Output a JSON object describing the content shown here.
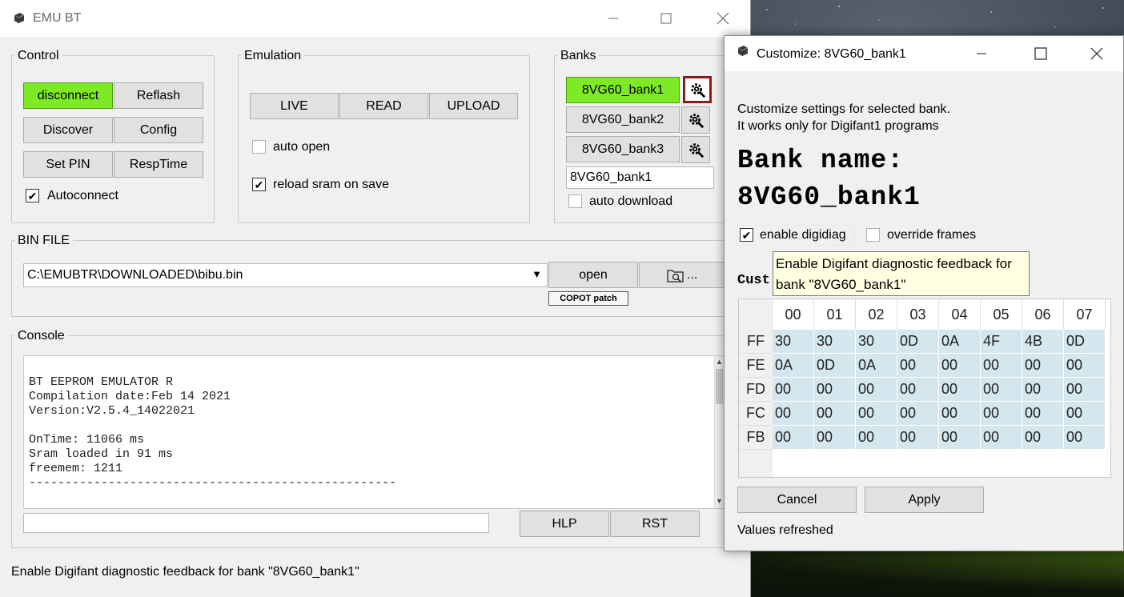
{
  "main_window": {
    "title": "EMU BT",
    "control": {
      "title": "Control",
      "disconnect": "disconnect",
      "reflash": "Reflash",
      "discover": "Discover",
      "config": "Config",
      "set_pin": "Set PIN",
      "resp_time": "RespTime",
      "autoconnect_label": "Autoconnect",
      "autoconnect_checked": true
    },
    "emulation": {
      "title": "Emulation",
      "live": "LIVE",
      "read": "READ",
      "upload": "UPLOAD",
      "auto_open_label": "auto open",
      "auto_open_checked": false,
      "reload_label": "reload sram on save",
      "reload_checked": true
    },
    "banks": {
      "title": "Banks",
      "items": [
        {
          "label": "8VG60_bank1",
          "active": true
        },
        {
          "label": "8VG60_bank2",
          "active": false
        },
        {
          "label": "8VG60_bank3",
          "active": false
        }
      ],
      "name_value": "8VG60_bank1",
      "auto_download_label": "auto download",
      "auto_download_checked": false
    },
    "bin_file": {
      "title": "BIN FILE",
      "path": "C:\\EMUBTR\\DOWNLOADED\\bibu.bin",
      "open": "open",
      "browse_label": "...",
      "copot_patch": "COPOT patch"
    },
    "console": {
      "title": "Console",
      "text": "BT EEPROM EMULATOR R\nCompilation date:Feb 14 2021\nVersion:V2.5.4_14022021\n\nOnTime: 11066 ms\nSram loaded in 91 ms\nfreemem: 1211\n---------------------------------------------------",
      "input_value": "",
      "hlp": "HLP",
      "rst": "RST"
    },
    "status_bar": "Enable Digifant diagnostic feedback for bank \"8VG60_bank1\""
  },
  "dialog": {
    "title": "Customize: 8VG60_bank1",
    "description_line1": "Customize settings for selected bank.",
    "description_line2": "It works only for Digifant1 programs",
    "bank_name_label": "Bank name:",
    "bank_name_value": "8VG60_bank1",
    "enable_digidiag_label": "enable digidiag",
    "enable_digidiag_checked": true,
    "override_frames_label": "override frames",
    "override_frames_checked": false,
    "custom_label_partial": "Cust",
    "grid": {
      "columns": [
        "00",
        "01",
        "02",
        "03",
        "04",
        "05",
        "06",
        "07"
      ],
      "rows": [
        {
          "label": "FF",
          "values": [
            "30",
            "30",
            "30",
            "0D",
            "0A",
            "4F",
            "4B",
            "0D"
          ]
        },
        {
          "label": "FE",
          "values": [
            "0A",
            "0D",
            "0A",
            "00",
            "00",
            "00",
            "00",
            "00"
          ]
        },
        {
          "label": "FD",
          "values": [
            "00",
            "00",
            "00",
            "00",
            "00",
            "00",
            "00",
            "00"
          ]
        },
        {
          "label": "FC",
          "values": [
            "00",
            "00",
            "00",
            "00",
            "00",
            "00",
            "00",
            "00"
          ]
        },
        {
          "label": "FB",
          "values": [
            "00",
            "00",
            "00",
            "00",
            "00",
            "00",
            "00",
            "00"
          ]
        }
      ]
    },
    "cancel": "Cancel",
    "apply": "Apply",
    "status": "Values refreshed",
    "tooltip": "Enable Digifant diagnostic feedback for bank \"8VG60_bank1\""
  },
  "colors": {
    "active_green": "#7dea25",
    "selected_border": "#8b1a1a",
    "grid_cell": "#d5e7ee",
    "tooltip_bg": "#ffffe1"
  },
  "icons": [
    "app-icon",
    "minimize-icon",
    "maximize-icon",
    "close-icon",
    "gear-wrench-icon",
    "folder-search-icon",
    "chevron-down-icon",
    "scroll-up-icon",
    "scroll-down-icon"
  ]
}
